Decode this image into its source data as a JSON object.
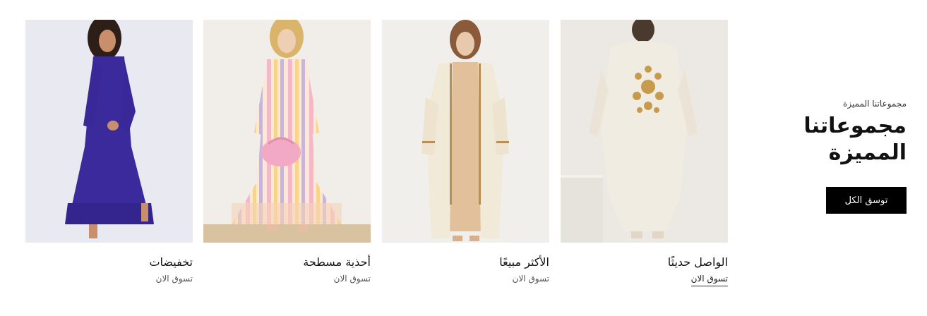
{
  "intro": {
    "eyebrow": "مجموعاتنا المميزة",
    "title": "مجموعاتنا المميزة",
    "shop_all": "توسق الكل"
  },
  "cards": [
    {
      "name": "الواصل حديثًا",
      "link": "تسوق الان",
      "image": "embroidered-cream-kimono-back-view"
    },
    {
      "name": "الأكثر مبيعًا",
      "link": "تسوق الان",
      "image": "cream-abaya-over-beige-dress"
    },
    {
      "name": "أحذية مسطحة",
      "link": "تسوق الان",
      "image": "striped-pastel-maxi-dress-pink-bag"
    },
    {
      "name": "تخفيضات",
      "link": "تسوق الان",
      "image": "indigo-maxi-dress"
    }
  ],
  "colors": {
    "button_bg": "#000000",
    "button_text": "#ffffff",
    "indigo_dress": "#3b2a9c",
    "cream": "#efe7d6"
  }
}
